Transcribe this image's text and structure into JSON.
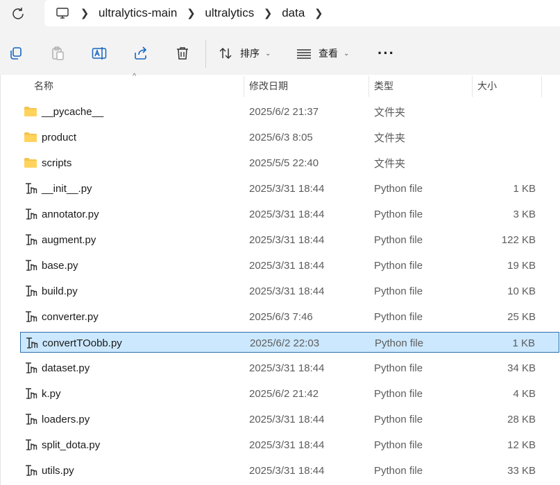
{
  "breadcrumb": [
    "ultralytics-main",
    "ultralytics",
    "data"
  ],
  "toolbar": {
    "sort_label": "排序",
    "view_label": "查看"
  },
  "columns": {
    "name": "名称",
    "date": "修改日期",
    "type": "类型",
    "size": "大小"
  },
  "files": [
    {
      "name": "__pycache__",
      "date": "2025/6/2 21:37",
      "type": "文件夹",
      "size": "",
      "kind": "folder"
    },
    {
      "name": "product",
      "date": "2025/6/3 8:05",
      "type": "文件夹",
      "size": "",
      "kind": "folder"
    },
    {
      "name": "scripts",
      "date": "2025/5/5 22:40",
      "type": "文件夹",
      "size": "",
      "kind": "folder"
    },
    {
      "name": "__init__.py",
      "date": "2025/3/31 18:44",
      "type": "Python file",
      "size": "1 KB",
      "kind": "python"
    },
    {
      "name": "annotator.py",
      "date": "2025/3/31 18:44",
      "type": "Python file",
      "size": "3 KB",
      "kind": "python"
    },
    {
      "name": "augment.py",
      "date": "2025/3/31 18:44",
      "type": "Python file",
      "size": "122 KB",
      "kind": "python"
    },
    {
      "name": "base.py",
      "date": "2025/3/31 18:44",
      "type": "Python file",
      "size": "19 KB",
      "kind": "python"
    },
    {
      "name": "build.py",
      "date": "2025/3/31 18:44",
      "type": "Python file",
      "size": "10 KB",
      "kind": "python"
    },
    {
      "name": "converter.py",
      "date": "2025/6/3 7:46",
      "type": "Python file",
      "size": "25 KB",
      "kind": "python"
    },
    {
      "name": "convertTOobb.py",
      "date": "2025/6/2 22:03",
      "type": "Python file",
      "size": "1 KB",
      "kind": "python",
      "selected": true
    },
    {
      "name": "dataset.py",
      "date": "2025/3/31 18:44",
      "type": "Python file",
      "size": "34 KB",
      "kind": "python"
    },
    {
      "name": "k.py",
      "date": "2025/6/2 21:42",
      "type": "Python file",
      "size": "4 KB",
      "kind": "python"
    },
    {
      "name": "loaders.py",
      "date": "2025/3/31 18:44",
      "type": "Python file",
      "size": "28 KB",
      "kind": "python"
    },
    {
      "name": "split_dota.py",
      "date": "2025/3/31 18:44",
      "type": "Python file",
      "size": "12 KB",
      "kind": "python"
    },
    {
      "name": "utils.py",
      "date": "2025/3/31 18:44",
      "type": "Python file",
      "size": "33 KB",
      "kind": "python"
    }
  ],
  "colors": {
    "selection_bg": "#cce8ff",
    "selection_border": "#2b6ea8",
    "folder": "#f4c44e"
  }
}
